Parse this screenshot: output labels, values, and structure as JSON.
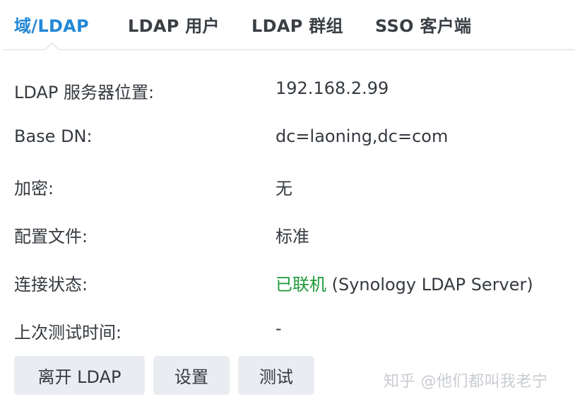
{
  "tabs": [
    {
      "label": "域/LDAP",
      "active": true
    },
    {
      "label": "LDAP 用户",
      "active": false
    },
    {
      "label": "LDAP 群组",
      "active": false
    },
    {
      "label": "SSO 客户端",
      "active": false
    }
  ],
  "info": {
    "server_label": "LDAP 服务器位置:",
    "server_value": "192.168.2.99",
    "basedn_label": "Base DN:",
    "basedn_value": "dc=laoning,dc=com",
    "encryption_label": "加密:",
    "encryption_value": "无",
    "profile_label": "配置文件:",
    "profile_value": "标准",
    "connection_label": "连接状态:",
    "connection_status": "已联机",
    "connection_detail": " (Synology LDAP Server)",
    "lasttest_label": "上次测试时间:",
    "lasttest_value": "-"
  },
  "buttons": {
    "leave_label": "离开 LDAP",
    "settings_label": "设置",
    "test_label": "测试"
  },
  "watermark": "知乎 @他们都叫我老宁",
  "colors": {
    "accent": "#2287d6",
    "status_ok": "#1f9a3a",
    "button_bg": "#e9ecf0"
  }
}
